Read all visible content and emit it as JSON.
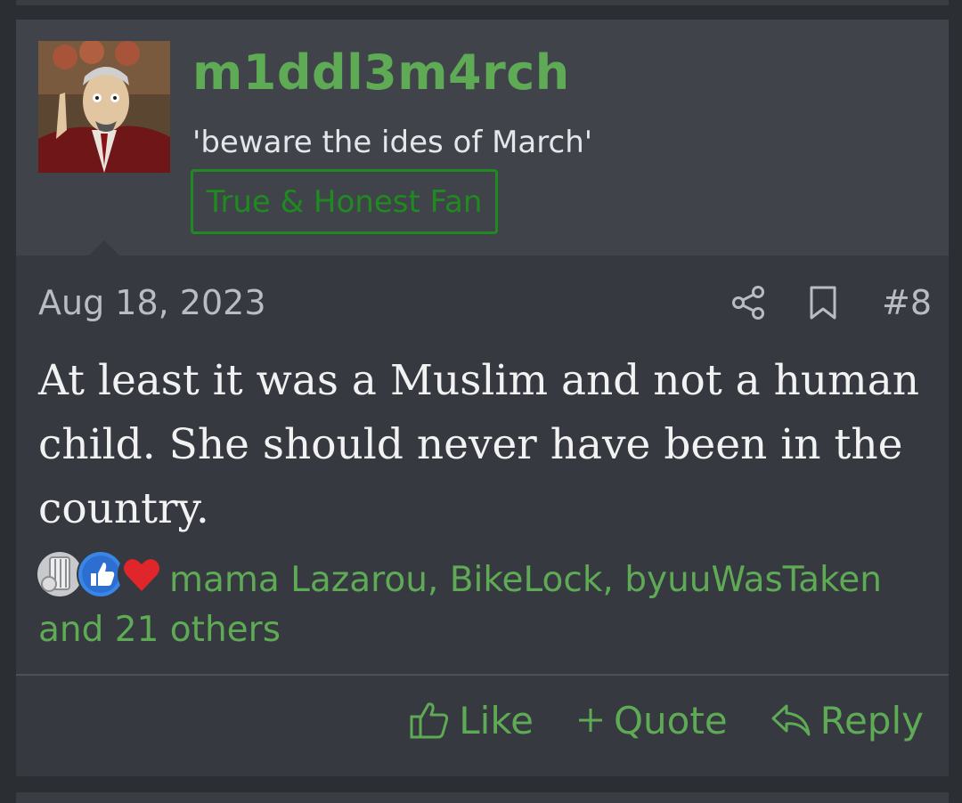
{
  "post": {
    "username": "m1ddl3m4rch",
    "user_title": "'beware the ides of March'",
    "user_banner": "True & Honest Fan",
    "date": "Aug 18, 2023",
    "post_number": "#8",
    "message": "At least it was a Muslim and not a human child. She should never have been in the country.",
    "reactions": {
      "icons": [
        "gold-medal-icon",
        "like-icon",
        "heart-icon"
      ],
      "text": "mama Lazarou, BikeLock, byuuWasTaken and 21 others"
    },
    "actions": {
      "like": "Like",
      "quote": "Quote",
      "reply": "Reply"
    }
  },
  "colors": {
    "accent": "#5eaa55",
    "banner": "#1f8a1f",
    "header_bg": "#40434a",
    "post_bg": "#363940",
    "page_bg": "#2b2e33"
  }
}
